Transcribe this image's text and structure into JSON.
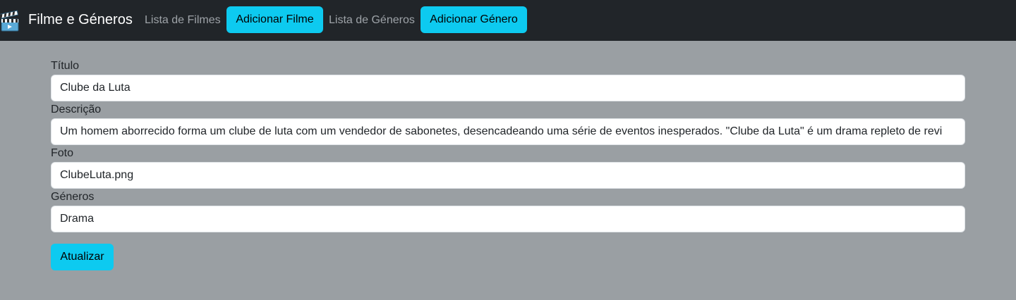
{
  "navbar": {
    "brand_icon": "clapperboard-icon",
    "brand": "Filme e Géneros",
    "links": {
      "list_films": "Lista de Filmes",
      "add_film": "Adicionar Filme",
      "list_genres": "Lista de Géneros",
      "add_genre": "Adicionar Género"
    }
  },
  "form": {
    "title_label": "Título",
    "title_value": "Clube da Luta",
    "description_label": "Descrição",
    "description_value": "Um homem aborrecido forma um clube de luta com um vendedor de sabonetes, desencadeando uma série de eventos inesperados. \"Clube da Luta\" é um drama repleto de revi",
    "photo_label": "Foto",
    "photo_value": "ClubeLuta.png",
    "genres_label": "Géneros",
    "genres_value": "Drama",
    "submit_label": "Atualizar"
  },
  "colors": {
    "navbar_bg": "#212529",
    "page_bg": "#9a9fa3",
    "accent": "#0dcaf0"
  }
}
